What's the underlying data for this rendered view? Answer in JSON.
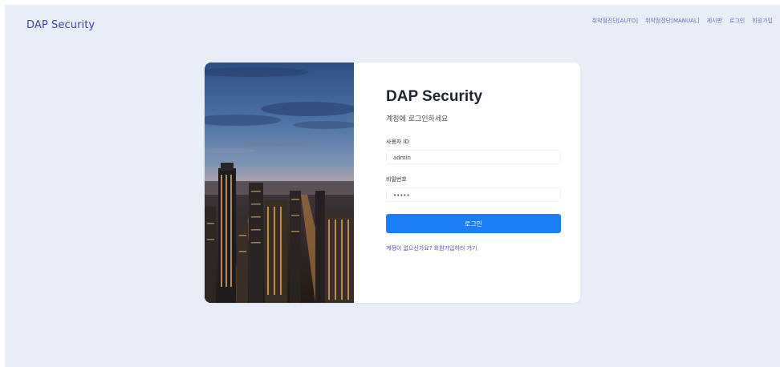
{
  "header": {
    "brand": "DAP Security",
    "nav": [
      {
        "label": "취약점진단[AUTO]"
      },
      {
        "label": "취약점진단[MANUAL]"
      },
      {
        "label": "게시판"
      },
      {
        "label": "로그인"
      },
      {
        "label": "회원가입"
      }
    ]
  },
  "login": {
    "title": "DAP Security",
    "subtitle": "계정에 로그인하세요",
    "username_label": "사용자 ID",
    "username_value": "admin",
    "password_label": "비밀번호",
    "password_value": "•••••",
    "submit_label": "로그인",
    "signup_link": "계정이 없으신가요? 회원가입하러 가기"
  },
  "colors": {
    "background": "#e9eef6",
    "brand": "#3d44b0",
    "nav": "#6a6fbe",
    "primary_button": "#1a7ff7"
  }
}
